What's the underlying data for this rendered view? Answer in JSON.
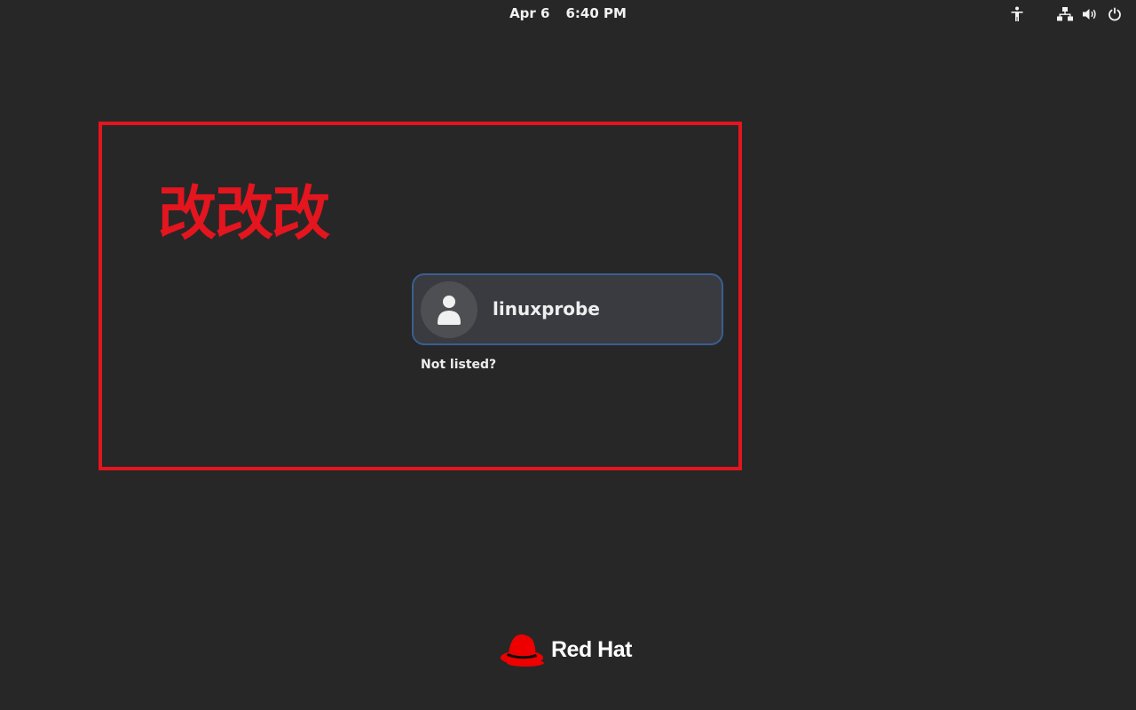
{
  "topbar": {
    "date": "Apr 6",
    "time": "6:40 PM",
    "icons": [
      "accessibility-icon",
      "network-wired-icon",
      "volume-icon",
      "power-icon"
    ]
  },
  "annotation": {
    "text": "改改改",
    "color": "#e3151e"
  },
  "login": {
    "users": [
      {
        "name": "linuxprobe",
        "avatar": "user-avatar-icon"
      }
    ],
    "not_listed_label": "Not listed?"
  },
  "branding": {
    "name": "Red Hat",
    "logo": "red-hat-logo-icon",
    "logo_color": "#ee0000"
  },
  "colors": {
    "background": "#272727",
    "card": "#393b40",
    "card_border": "#3a5f91"
  }
}
